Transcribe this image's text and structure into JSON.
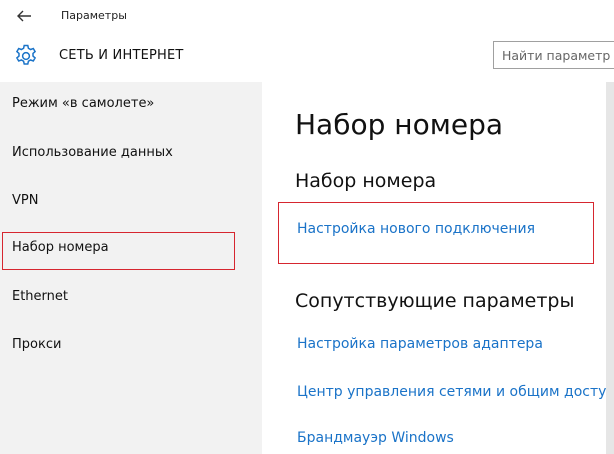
{
  "titlebar": {
    "back_icon": "arrow-left-icon",
    "title": "Параметры"
  },
  "header": {
    "icon": "gear-icon",
    "section_title": "СЕТЬ И ИНТЕРНЕТ",
    "search_placeholder": "Найти параметр"
  },
  "sidebar": {
    "items": [
      {
        "label": "Режим «в самолете»"
      },
      {
        "label": "Использование данных"
      },
      {
        "label": "VPN"
      },
      {
        "label": "Набор номера",
        "selected": true
      },
      {
        "label": "Ethernet"
      },
      {
        "label": "Прокси"
      }
    ]
  },
  "main": {
    "page_title": "Набор номера",
    "dialup_heading": "Набор номера",
    "setup_link": "Настройка нового подключения",
    "related_heading": "Сопутствующие параметры",
    "related_links": [
      "Настройка параметров адаптера",
      "Центр управления сетями и общим доступом",
      "Брандмауэр Windows"
    ]
  },
  "colors": {
    "link": "#1a73c8",
    "highlight": "#d6262f",
    "sidebar_bg": "#f2f2f2"
  }
}
